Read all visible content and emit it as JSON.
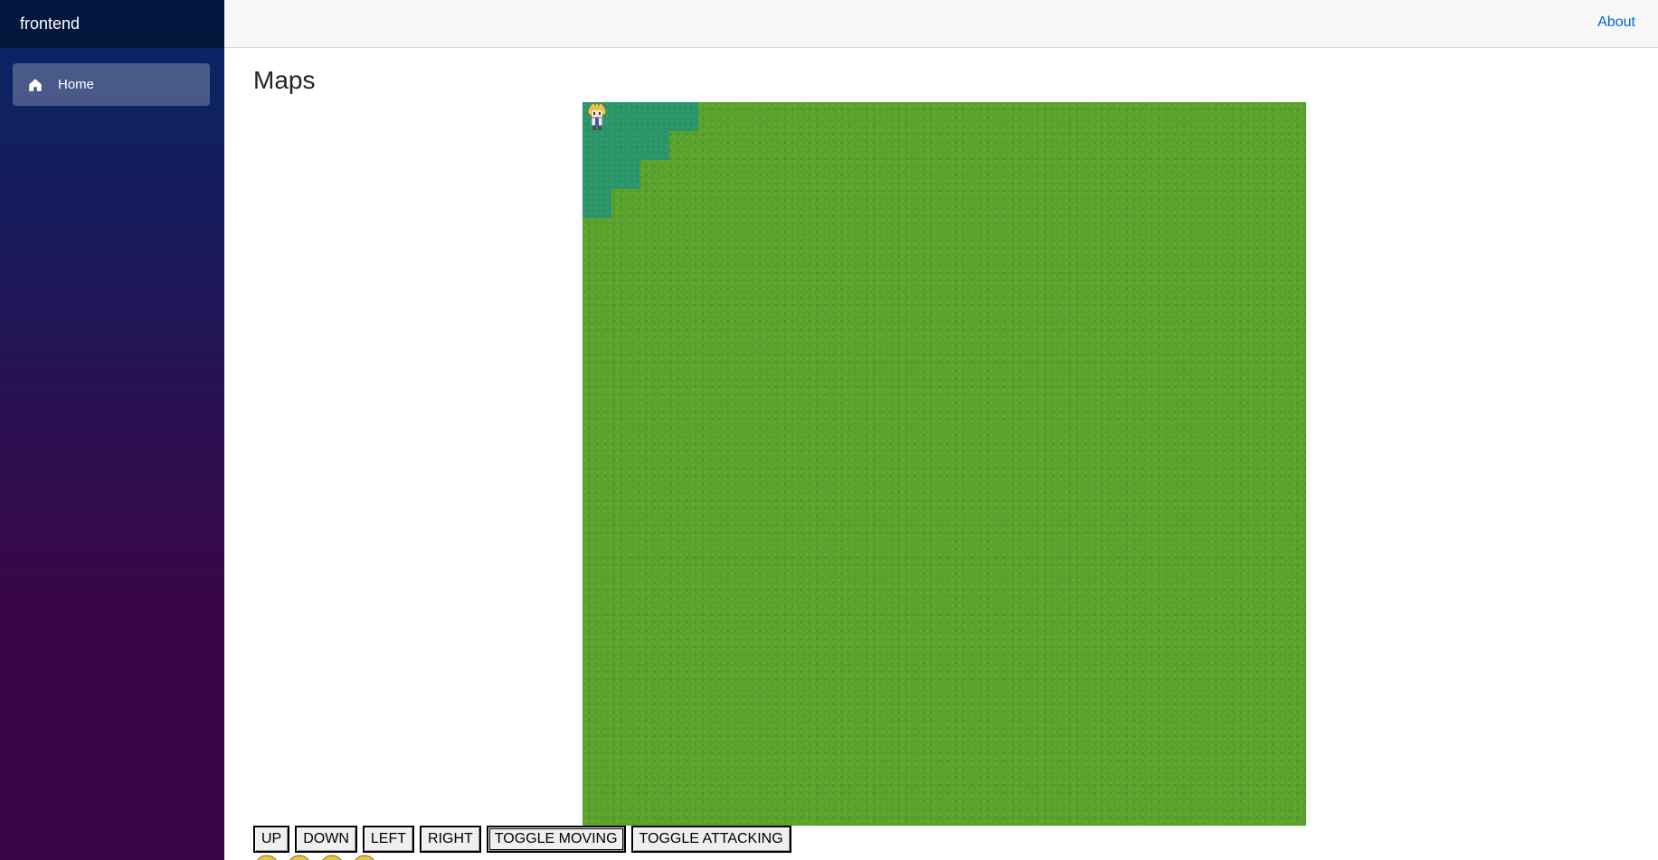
{
  "app": {
    "brand": "frontend"
  },
  "sidebar": {
    "items": [
      {
        "label": "Home",
        "icon": "home-icon"
      }
    ]
  },
  "topbar": {
    "about_label": "About"
  },
  "page": {
    "title": "Maps"
  },
  "map": {
    "terrain": [
      "grass",
      "water"
    ],
    "colors": {
      "grass": "#5aa22d",
      "water": "#2a9469"
    },
    "character": "hero-sprite"
  },
  "controls": {
    "up": "UP",
    "down": "DOWN",
    "left": "LEFT",
    "right": "RIGHT",
    "toggle_moving": "TOGGLE MOVING",
    "toggle_attacking": "TOGGLE ATTACKING"
  },
  "sprite_sheet": {
    "count": 4
  },
  "colors": {
    "sidebar_top": "#052767",
    "sidebar_bottom": "#3a0647",
    "link": "#0366d6",
    "topbar_bg": "#f7f7f7"
  }
}
